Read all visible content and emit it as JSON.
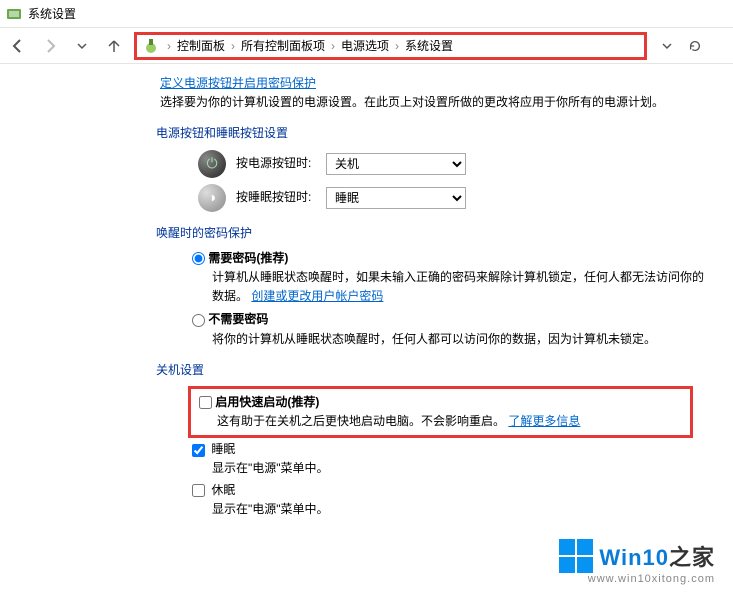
{
  "window": {
    "title": "系统设置"
  },
  "breadcrumb": {
    "items": [
      "控制面板",
      "所有控制面板项",
      "电源选项",
      "系统设置"
    ]
  },
  "top_link": "定义电源按钮并启用密码保护",
  "description": "选择要为你的计算机设置的电源设置。在此页上对设置所做的更改将应用于你所有的电源计划。",
  "section_buttons": "电源按钮和睡眠按钮设置",
  "power_button": {
    "label": "按电源按钮时:",
    "value": "关机"
  },
  "sleep_button": {
    "label": "按睡眠按钮时:",
    "value": "睡眠"
  },
  "section_wake": "唤醒时的密码保护",
  "radio_require": {
    "label": "需要密码(推荐)",
    "desc_prefix": "计算机从睡眠状态唤醒时，如果未输入正确的密码来解除计算机锁定，任何人都无法访问你的数据。",
    "link": "创建或更改用户帐户密码"
  },
  "radio_norequire": {
    "label": "不需要密码",
    "desc": "将你的计算机从睡眠状态唤醒时，任何人都可以访问你的数据，因为计算机未锁定。"
  },
  "section_shutdown": "关机设置",
  "chk_fast": {
    "label": "启用快速启动(推荐)",
    "desc_prefix": "这有助于在关机之后更快地启动电脑。不会影响重启。",
    "link": "了解更多信息"
  },
  "chk_sleep": {
    "label": "睡眠",
    "desc": "显示在\"电源\"菜单中。"
  },
  "chk_hibernate": {
    "label": "休眠",
    "desc": "显示在\"电源\"菜单中。"
  },
  "watermark": {
    "brand_main": "Win10",
    "brand_suffix": "之家",
    "url": "www.win10xitong.com"
  }
}
